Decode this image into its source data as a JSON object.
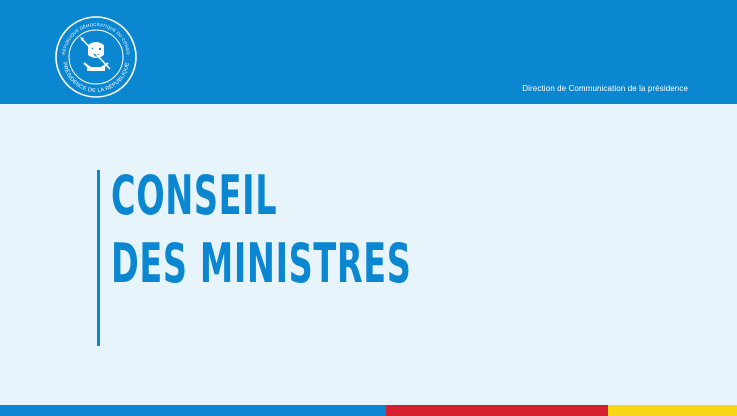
{
  "header": {
    "credit": "Direction de Communication de la présidence"
  },
  "seal": {
    "top_text": "RÉPUBLIQUE DÉMOCRATIQUE DU CONGO",
    "bottom_text": "PRÉSIDENCE DE LA RÉPUBLIQUE",
    "color": "#ffffff"
  },
  "title": {
    "line1": "CONSEIL",
    "line2": "DES MINISTRES"
  },
  "colors": {
    "blue": "#0b87d2",
    "red": "#d61f2e",
    "yellow": "#f9d616",
    "background": "#e8f4fb"
  }
}
